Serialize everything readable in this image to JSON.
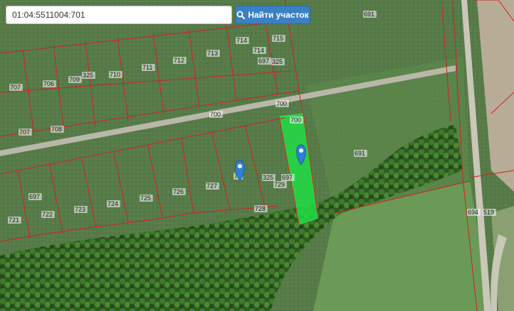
{
  "search": {
    "value": "01:04:5511004:701",
    "button_label": "Найти участок"
  },
  "plot_numbers": [
    "707",
    "706",
    "709",
    "325",
    "710",
    "711",
    "712",
    "713",
    "714",
    "715",
    "714",
    "697",
    "325",
    "691",
    "707",
    "708",
    "700",
    "700",
    "700",
    "691",
    "697",
    "722",
    "723",
    "724",
    "725",
    "726",
    "727",
    "72",
    "325",
    "697",
    "729",
    "728",
    "721",
    "694",
    "519"
  ],
  "colors": {
    "highlight_fill": "#22dd44",
    "boundary_line": "#d42020",
    "button": "#3b7fc4",
    "marker": "#2f7fd6"
  },
  "markers": [
    "location-pin-icon",
    "location-pin-icon"
  ],
  "selected_parcel": "701"
}
